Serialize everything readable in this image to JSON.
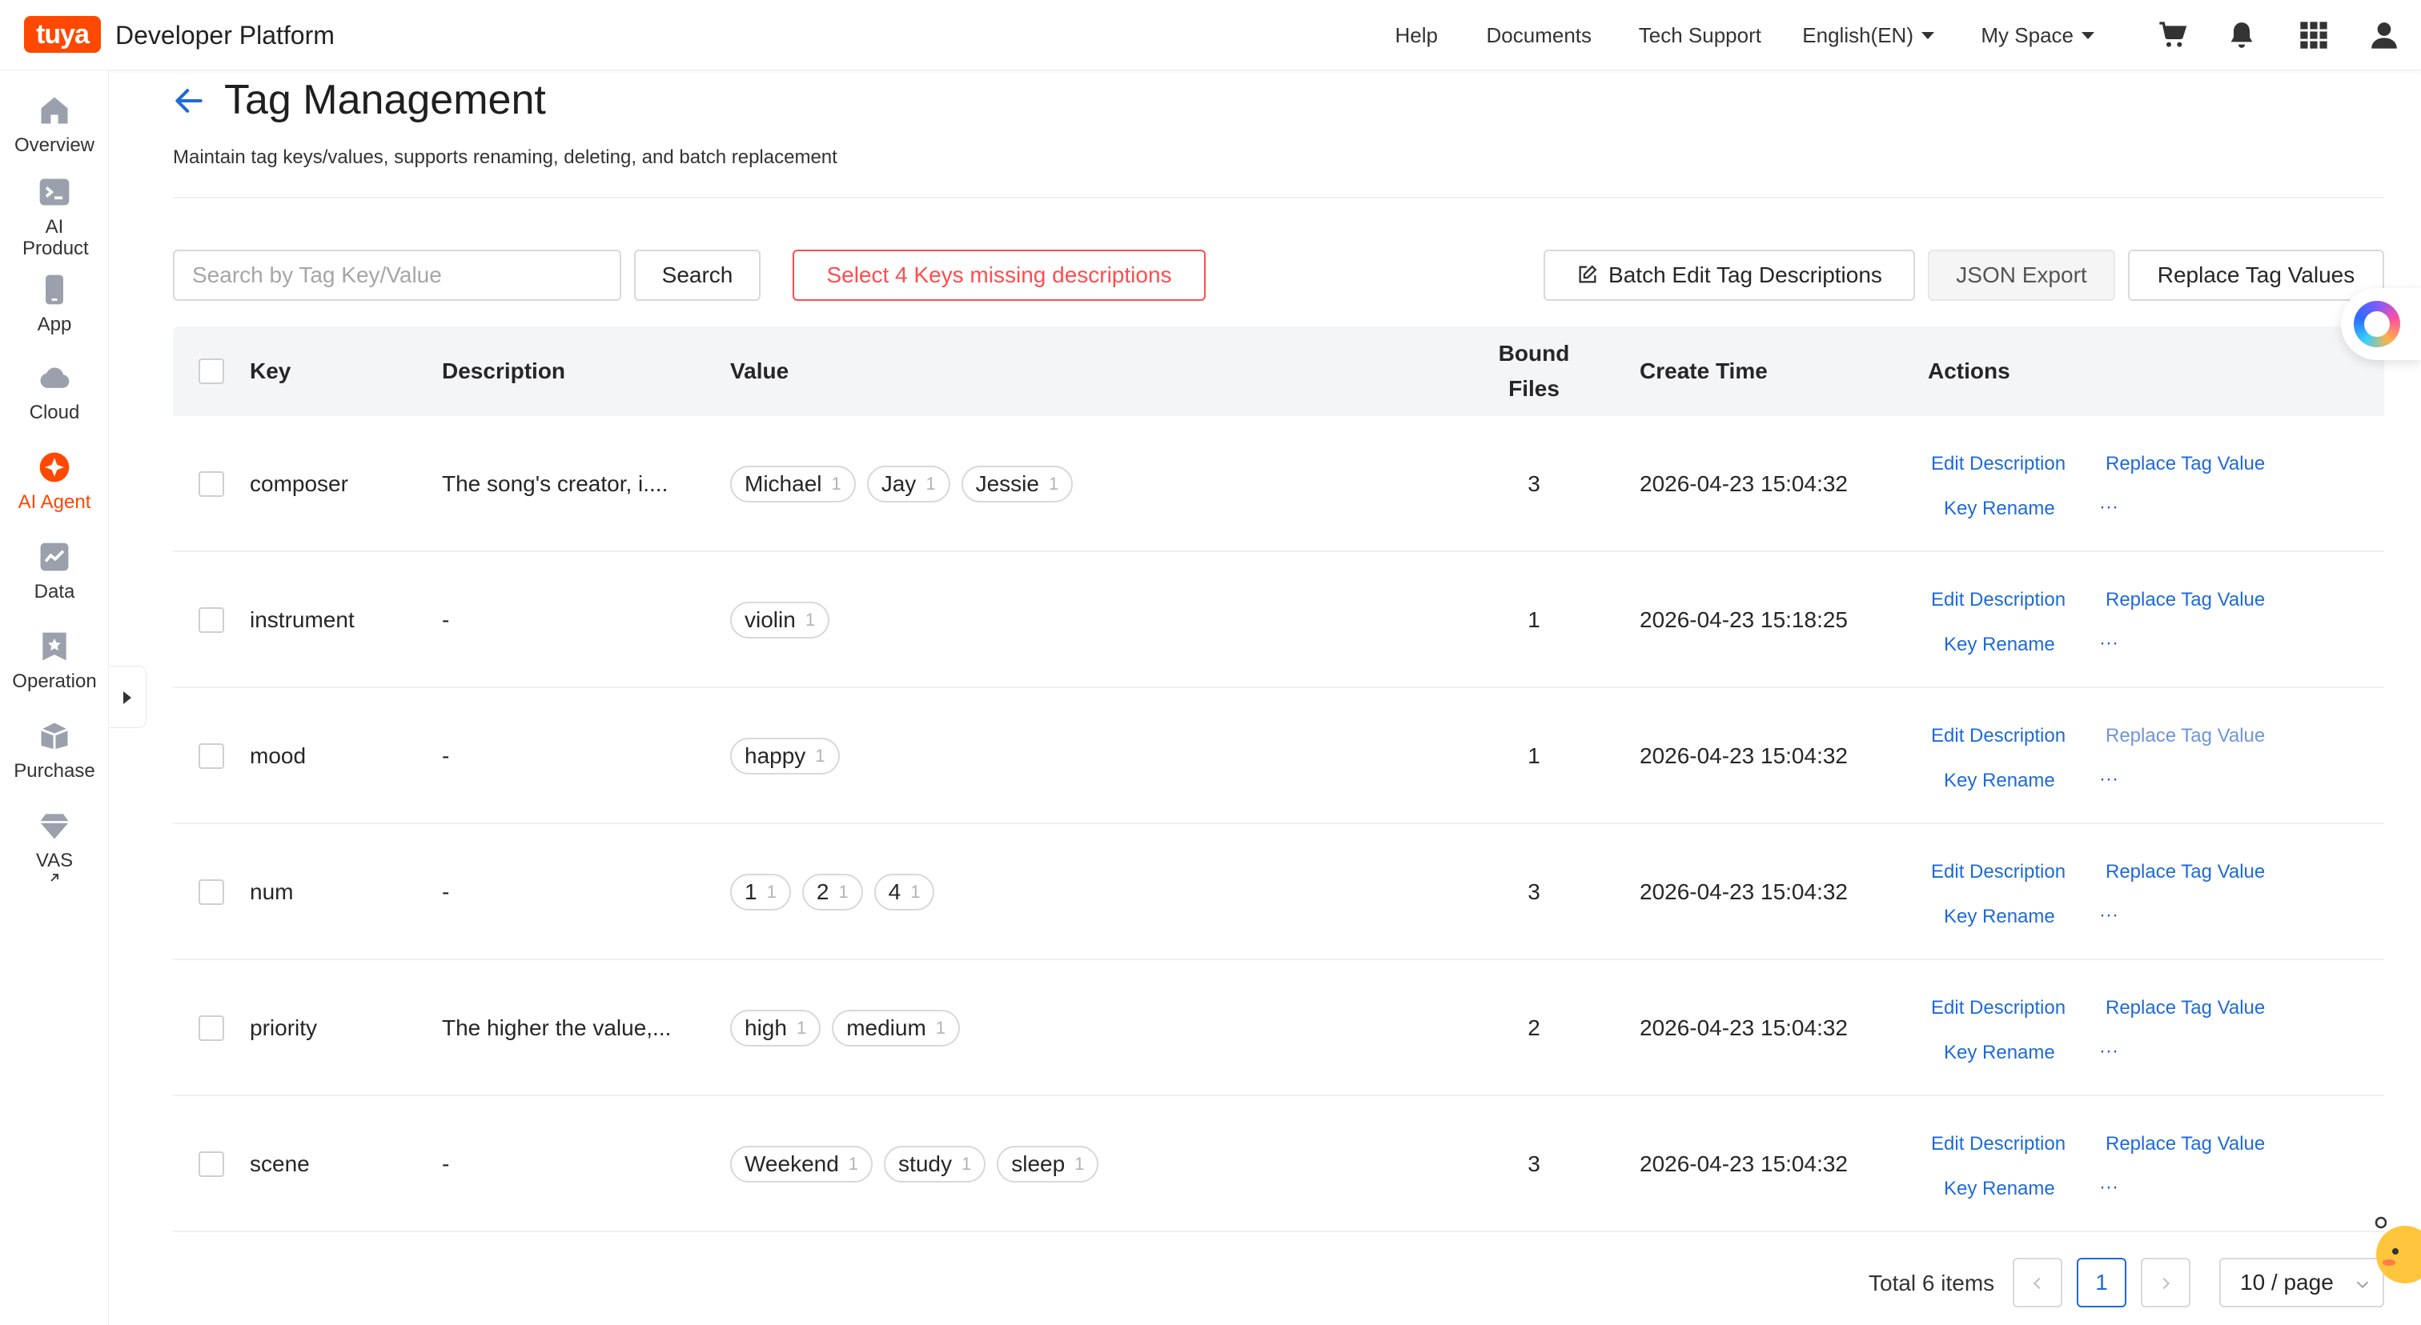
{
  "brand": {
    "logo_text": "tuya",
    "name": "Developer Platform"
  },
  "topnav": {
    "help": "Help",
    "documents": "Documents",
    "tech_support": "Tech Support",
    "language": "English(EN)",
    "space": "My Space"
  },
  "sidebar": {
    "items": [
      {
        "label": "Overview"
      },
      {
        "label": "AI Product"
      },
      {
        "label": "App"
      },
      {
        "label": "Cloud"
      },
      {
        "label": "AI Agent"
      },
      {
        "label": "Data"
      },
      {
        "label": "Operation"
      },
      {
        "label": "Purchase"
      },
      {
        "label": "VAS"
      }
    ]
  },
  "page": {
    "title": "Tag Management",
    "subtitle": "Maintain tag keys/values, supports renaming, deleting, and batch replacement"
  },
  "toolbar": {
    "search_placeholder": "Search by Tag Key/Value",
    "search_label": "Search",
    "missing_label": "Select 4 Keys missing descriptions",
    "batch_edit_label": "Batch Edit Tag Descriptions",
    "json_export_label": "JSON Export",
    "replace_values_label": "Replace Tag Values"
  },
  "table": {
    "headers": {
      "key": "Key",
      "description": "Description",
      "value": "Value",
      "bound_line1": "Bound",
      "bound_line2": "Files",
      "create_time": "Create Time",
      "actions": "Actions"
    },
    "actions": {
      "edit_description": "Edit Description",
      "replace_tag_value": "Replace Tag Value",
      "key_rename": "Key Rename",
      "more": "···"
    },
    "rows": [
      {
        "key": "composer",
        "description": "The song's creator, i....",
        "values": [
          [
            "Michael",
            "1"
          ],
          [
            "Jay",
            "1"
          ],
          [
            "Jessie",
            "1"
          ]
        ],
        "bound": "3",
        "create_time": "2026-04-23 15:04:32"
      },
      {
        "key": "instrument",
        "description": "-",
        "values": [
          [
            "violin",
            "1"
          ]
        ],
        "bound": "1",
        "create_time": "2026-04-23 15:18:25"
      },
      {
        "key": "mood",
        "description": "-",
        "values": [
          [
            "happy",
            "1"
          ]
        ],
        "bound": "1",
        "create_time": "2026-04-23 15:04:32"
      },
      {
        "key": "num",
        "description": "-",
        "values": [
          [
            "1",
            "1"
          ],
          [
            "2",
            "1"
          ],
          [
            "4",
            "1"
          ]
        ],
        "bound": "3",
        "create_time": "2026-04-23 15:04:32"
      },
      {
        "key": "priority",
        "description": "The higher the value,...",
        "values": [
          [
            "high",
            "1"
          ],
          [
            "medium",
            "1"
          ]
        ],
        "bound": "2",
        "create_time": "2026-04-23 15:04:32"
      },
      {
        "key": "scene",
        "description": "-",
        "values": [
          [
            "Weekend",
            "1"
          ],
          [
            "study",
            "1"
          ],
          [
            "sleep",
            "1"
          ]
        ],
        "bound": "3",
        "create_time": "2026-04-23 15:04:32"
      }
    ]
  },
  "pagination": {
    "total": "Total 6 items",
    "current_page": "1",
    "page_size": "10 / page"
  },
  "colors": {
    "brand": "#ff4800",
    "link": "#1e6ad9",
    "danger": "#ff4d4f"
  }
}
